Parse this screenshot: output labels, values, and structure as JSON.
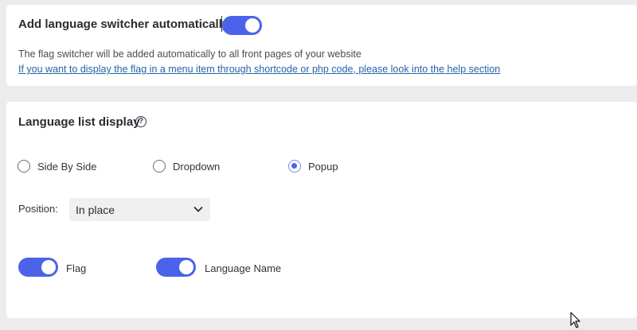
{
  "auto_switcher": {
    "title": "Add language switcher automatically",
    "toggle_on": true,
    "description": "The flag switcher will be added automatically to all front pages of your website",
    "help_link": "If you want to display the flag in a menu item through shortcode or php code, please look into the help section"
  },
  "language_list": {
    "title": "Language list display",
    "help_icon": "question-circle-icon",
    "display_options": [
      {
        "label": "Side By Side",
        "checked": false
      },
      {
        "label": "Dropdown",
        "checked": false
      },
      {
        "label": "Popup",
        "checked": true
      }
    ],
    "position_label": "Position:",
    "position_value": "In place",
    "flag_toggle": {
      "label": "Flag",
      "on": true
    },
    "language_name_toggle": {
      "label": "Language Name",
      "on": true
    }
  },
  "colors": {
    "accent": "#4a63e8",
    "link": "#2563a8",
    "background": "#ececee",
    "card": "#ffffff"
  }
}
